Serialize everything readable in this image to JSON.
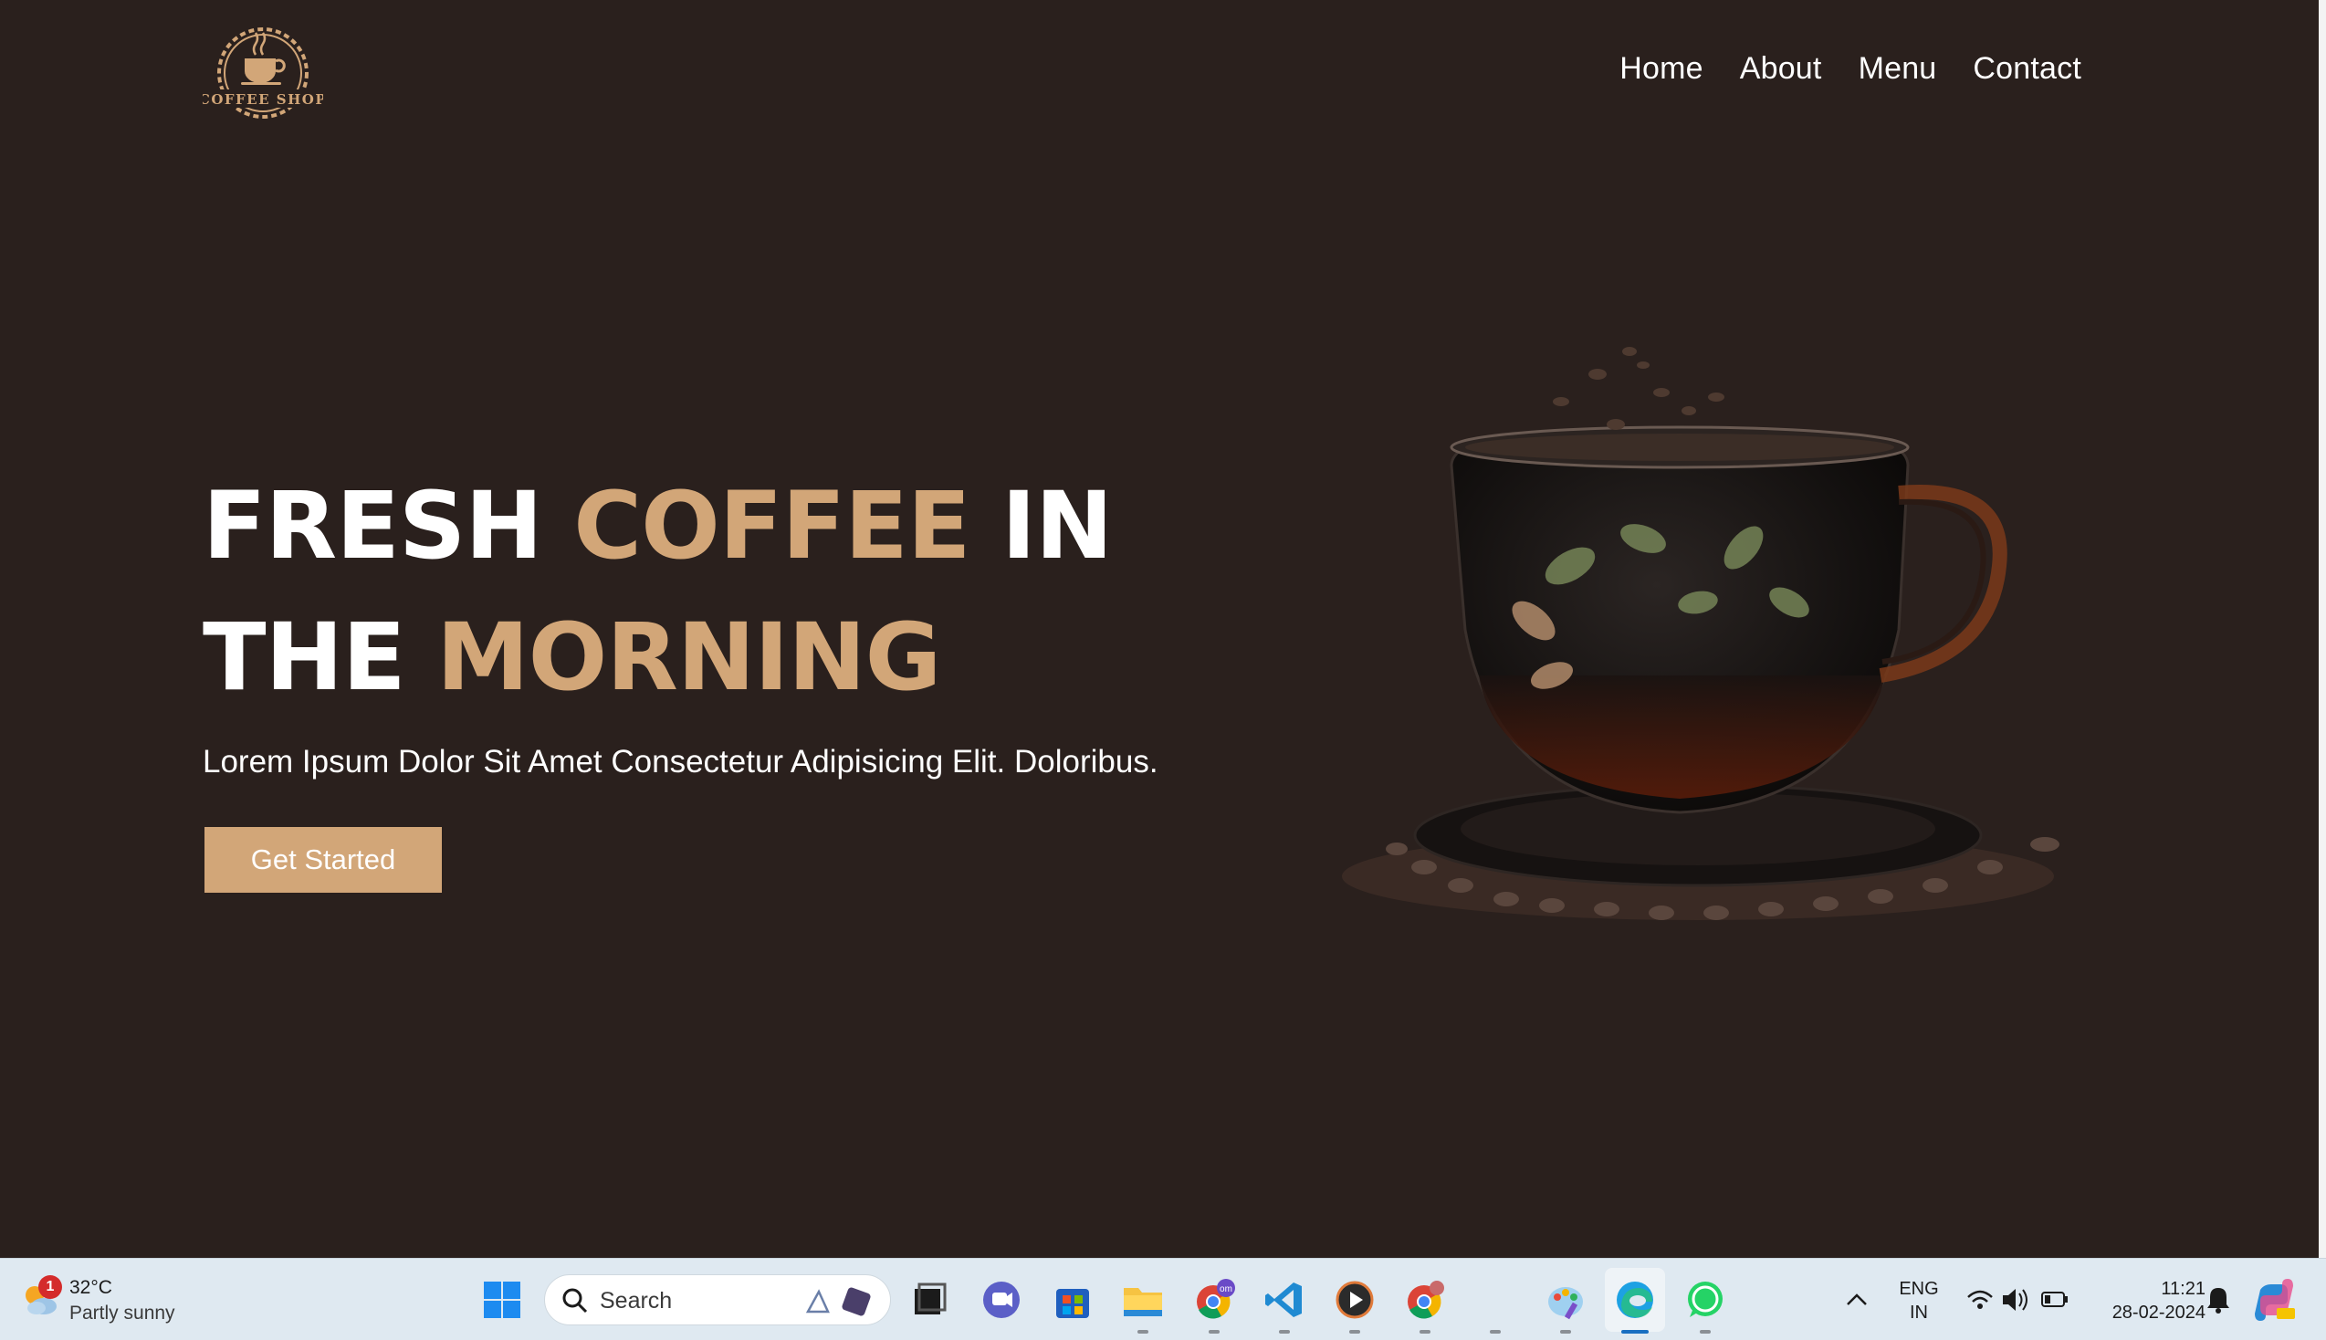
{
  "site": {
    "logo_text": "COFFEE SHOP",
    "nav": [
      {
        "label": "Home"
      },
      {
        "label": "About"
      },
      {
        "label": "Menu"
      },
      {
        "label": "Contact"
      }
    ],
    "hero": {
      "title_line1_part1": "FRESH ",
      "title_line1_accent": "COFFEE",
      "title_line1_part2": " IN",
      "title_line2_part1": "THE ",
      "title_line2_accent": "MORNING",
      "subtitle": "Lorem Ipsum Dolor Sit Amet Consectetur Adipisicing Elit. Doloribus.",
      "cta_label": "Get Started"
    },
    "colors": {
      "background": "#2a201d",
      "accent": "#d2a678",
      "text": "#ffffff"
    }
  },
  "taskbar": {
    "weather": {
      "temp": "32°C",
      "condition": "Partly sunny",
      "badge": "1"
    },
    "search_placeholder": "Search",
    "apps": [
      {
        "name": "windows-start-icon"
      },
      {
        "name": "task-view-icon"
      },
      {
        "name": "teams-chat-icon"
      },
      {
        "name": "microsoft-store-icon"
      },
      {
        "name": "file-explorer-icon"
      },
      {
        "name": "chrome-profile-icon",
        "badge": "om"
      },
      {
        "name": "vscode-icon"
      },
      {
        "name": "media-player-icon"
      },
      {
        "name": "chrome-icon"
      },
      {
        "name": "paint-icon"
      },
      {
        "name": "edge-icon"
      },
      {
        "name": "whatsapp-icon"
      }
    ],
    "tray": {
      "language_line1": "ENG",
      "language_line2": "IN",
      "time": "11:21",
      "date": "28-02-2024"
    }
  }
}
